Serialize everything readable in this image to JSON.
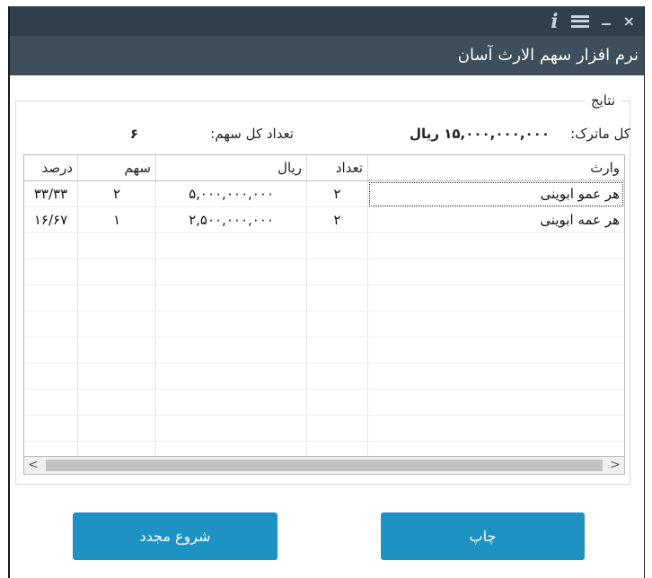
{
  "titlebar": {
    "info_icon": "i",
    "icons": [
      "info-icon",
      "menu-icon",
      "minimize-icon",
      "close-icon"
    ],
    "close_glyph": "×"
  },
  "app": {
    "title": "نرم افزار سهم الارث آسان"
  },
  "results": {
    "legend": "نتایج",
    "total_label": "کل ماترک:",
    "total_value": "۱۵,۰۰۰,۰۰۰,۰۰۰ ریال",
    "shares_label": "تعداد کل سهم:",
    "shares_value": "۶"
  },
  "table": {
    "columns": [
      "وارث",
      "تعداد",
      "ریال",
      "سهم",
      "درصد"
    ],
    "rows": [
      {
        "heir": "هر عمو ابوینی",
        "count": "۲",
        "rial": "۵,۰۰۰,۰۰۰,۰۰۰",
        "share": "۲",
        "percent": "۳۳/۳۳"
      },
      {
        "heir": "هر عمه ابوینی",
        "count": "۲",
        "rial": "۲,۵۰۰,۰۰۰,۰۰۰",
        "share": "۱",
        "percent": "۱۶/۶۷"
      }
    ]
  },
  "scrollbar": {
    "left_arrow": "<",
    "right_arrow": ">"
  },
  "buttons": {
    "restart": "شروع مجدد",
    "print": "چاپ"
  },
  "colors": {
    "titlebar": "#2f3f4b",
    "header": "#3e4e5b",
    "button": "#1d92c3"
  }
}
